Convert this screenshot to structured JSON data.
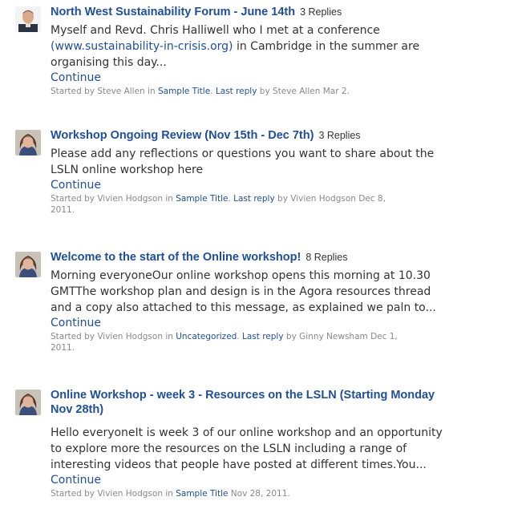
{
  "topics": [
    {
      "title": "North West Sustainability Forum - June 14th",
      "replies": "3 Replies",
      "excerpt_line1": "Myself and Revd. Chris Halliwell who I met at a conference",
      "excerpt_url": "(www.sustainability-in-crisis.org)",
      "excerpt_line2_rest": " in Cambridge in the summer are",
      "excerpt_line3": "organising this day...",
      "continue": "Continue",
      "meta_started": "Started by Steve Allen in ",
      "meta_forum": "Sample Title",
      "meta_mid": ". ",
      "meta_last_reply": "Last reply",
      "meta_tail": " by Steve Allen Mar 2.",
      "avatar": "man-avatar"
    },
    {
      "title": "Workshop Ongoing Review (Nov 15th - Dec 7th)",
      "replies": "3 Replies",
      "excerpt_line1": "Please add any reflections or questions you want to share about the",
      "excerpt_line2": "LSLN online workshop here",
      "continue": "Continue",
      "meta_started": "Started by Vivien Hodgson in ",
      "meta_forum": "Sample Title",
      "meta_mid": ". ",
      "meta_last_reply": "Last reply",
      "meta_tail": " by Vivien Hodgson Dec 8,",
      "meta_line2": "2011.",
      "avatar": "woman-avatar"
    },
    {
      "title": "Welcome to the start of the Online workshop!",
      "replies": "8 Replies",
      "excerpt_line1": "Morning everyoneOur online workshop opens this morning at 10.30",
      "excerpt_line2": "GMTThe workshop plan and design is in the Agora resources thread",
      "excerpt_line3": "and a copy also attached to this message, as explained we paln to...",
      "continue": "Continue",
      "meta_started": "Started by Vivien Hodgson in ",
      "meta_forum": "Uncategorized",
      "meta_mid": ". ",
      "meta_last_reply": "Last reply",
      "meta_tail": " by Ginny Newsham Dec 1,",
      "meta_line2": "2011.",
      "avatar": "woman-avatar"
    },
    {
      "title": "Online Workshop - week 3 - Resources on the LSLN (Starting Monday",
      "title_line2": "Nov 28th)",
      "excerpt_line1": "Hello everyoneIt is week 3 of our online workshop and an opportunity",
      "excerpt_line2": "to explore more the resources on the LSLN including a range of",
      "excerpt_line3": "interesting videos that people have posted at different times.You...",
      "continue": "Continue",
      "meta_started": "Started by Vivien Hodgson in ",
      "meta_forum": "Sample Title",
      "meta_tail": " Nov 28, 2011.",
      "avatar": "woman-avatar"
    }
  ],
  "colors": {
    "link": "#1f4e9a",
    "text": "#333333",
    "meta": "#888888"
  }
}
